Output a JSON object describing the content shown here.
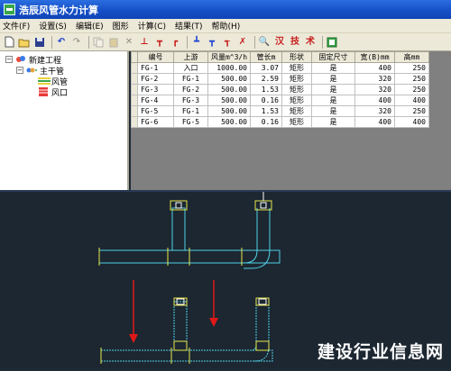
{
  "window": {
    "title": "浩辰风管水力计算",
    "accent": "#1650c8"
  },
  "menu": [
    "文件(F)",
    "设置(S)",
    "编辑(E)",
    "图形",
    "计算(C)",
    "结果(T)",
    "帮助(H)"
  ],
  "toolbar": {
    "icons": [
      "new-icon",
      "open-icon",
      "save-icon",
      "undo-icon",
      "redo-icon",
      "copy-icon",
      "paste-icon",
      "delete-icon",
      "duct-branch-icon",
      "duct-tee-icon",
      "duct-elbow-icon",
      "duct-fitting-icon",
      "calc-icon",
      "settings-icon",
      "check-icon",
      "export-icon"
    ],
    "text_buttons": [
      "汉",
      "技",
      "术"
    ]
  },
  "tree": {
    "root": "新建工程",
    "group": "主干管",
    "children": [
      "风管",
      "风口"
    ]
  },
  "table": {
    "headers": [
      "编号",
      "上游",
      "风量m^3/h",
      "管长m",
      "形状",
      "固定尺寸",
      "宽(B)mm",
      "高mm"
    ],
    "rows": [
      [
        "FG-1",
        "入口",
        "1000.00",
        "3.07",
        "矩形",
        "是",
        "400",
        "250"
      ],
      [
        "FG-2",
        "FG-1",
        "500.00",
        "2.59",
        "矩形",
        "是",
        "320",
        "250"
      ],
      [
        "FG-3",
        "FG-2",
        "500.00",
        "1.53",
        "矩形",
        "是",
        "320",
        "250"
      ],
      [
        "FG-4",
        "FG-3",
        "500.00",
        "0.16",
        "矩形",
        "是",
        "400",
        "400"
      ],
      [
        "FG-5",
        "FG-1",
        "500.00",
        "1.53",
        "矩形",
        "是",
        "320",
        "250"
      ],
      [
        "FG-6",
        "FG-5",
        "500.00",
        "0.16",
        "矩形",
        "是",
        "400",
        "400"
      ]
    ]
  },
  "watermark": "建设行业信息网",
  "colors": {
    "cad_bg": "#1c2731",
    "duct": "#4fd1e8",
    "duct_edge": "#e8e84a",
    "arrow": "#e01818"
  }
}
